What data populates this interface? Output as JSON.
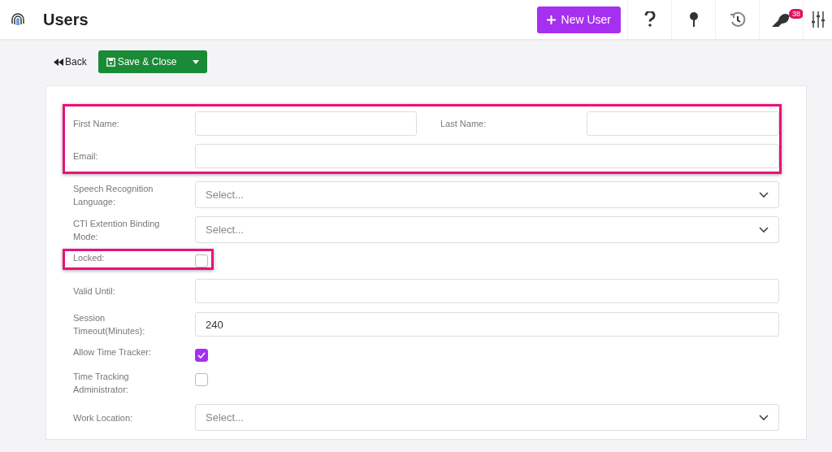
{
  "header": {
    "title": "Users",
    "new_button": "New User",
    "notification_count": "38"
  },
  "toolbar": {
    "back": "Back",
    "save": "Save & Close"
  },
  "sections": [
    {
      "highlighted": true,
      "rows": [
        {
          "kind": "pair",
          "label": "First Name:",
          "value": "",
          "label2": "Last Name:"
        },
        {
          "kind": "text",
          "label": "Email:"
        }
      ]
    },
    {
      "highlighted": false,
      "rows": [
        {
          "kind": "select",
          "label": "Speech Recognition Language:",
          "placeholder": "Select..."
        },
        {
          "kind": "select",
          "label": "CTI Extention Binding Mode:",
          "placeholder": "Select..."
        }
      ]
    },
    {
      "highlighted": true,
      "rows": [
        {
          "kind": "checkbox",
          "label": "Locked:",
          "checked": false
        }
      ]
    },
    {
      "highlighted": false,
      "rows": [
        {
          "kind": "text",
          "label": "Valid Until:"
        },
        {
          "kind": "text",
          "label": "Session Timeout(Minutes):",
          "value": "240"
        },
        {
          "kind": "checkbox",
          "label": "Allow Time Tracker:",
          "checked": true
        },
        {
          "kind": "checkbox",
          "label": "Time Tracking Administrator:",
          "checked": false
        },
        {
          "kind": "select",
          "label": "Work Location:",
          "placeholder": "Select..."
        }
      ]
    }
  ]
}
